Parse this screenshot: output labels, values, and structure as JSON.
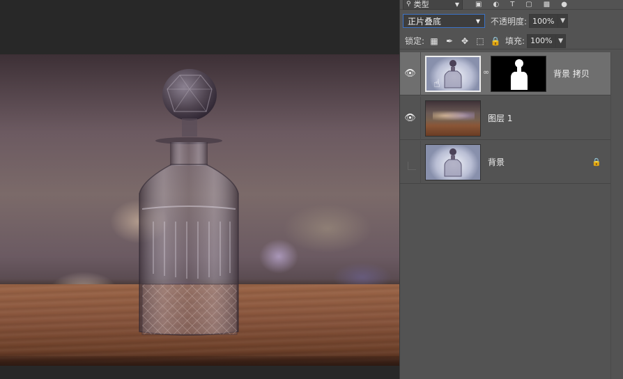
{
  "panel": {
    "filter": {
      "kind_label": "类型"
    },
    "blend_mode": "正片叠底",
    "opacity_label": "不透明度:",
    "opacity_value": "100%",
    "lock_label": "锁定:",
    "fill_label": "填充:",
    "fill_value": "100%",
    "layers": [
      {
        "name": "背景 拷贝",
        "visible": true,
        "selected": true,
        "has_mask": true
      },
      {
        "name": "图层 1",
        "visible": true,
        "selected": false,
        "has_mask": false
      },
      {
        "name": "背景",
        "visible": false,
        "selected": false,
        "locked": true
      }
    ]
  },
  "colors": {
    "panel_bg": "#535353",
    "selected_layer": "#6f6f6f",
    "focus_border": "#3b73c8",
    "workspace": "#282828"
  }
}
